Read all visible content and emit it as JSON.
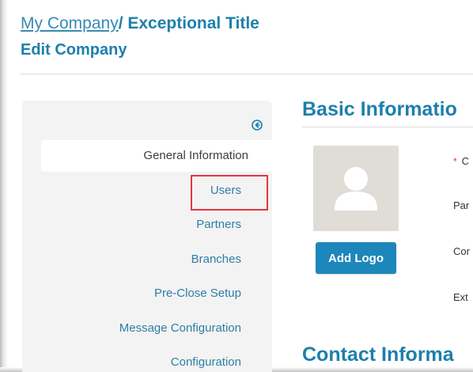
{
  "header": {
    "breadcrumb_root": "My Company",
    "breadcrumb_current": "/ Exceptional Title",
    "subtitle": "Edit Company"
  },
  "sidebar": {
    "collapse_icon": "collapse-left-circle-icon",
    "items": [
      {
        "label": "General Information",
        "active": true
      },
      {
        "label": "Users",
        "active": false,
        "highlighted": true
      },
      {
        "label": "Partners",
        "active": false
      },
      {
        "label": "Branches",
        "active": false
      },
      {
        "label": "Pre-Close Setup",
        "active": false
      },
      {
        "label": "Message Configuration",
        "active": false
      },
      {
        "label": "Configuration",
        "active": false
      }
    ]
  },
  "main": {
    "basic_info_title": "Basic Informatio",
    "contact_info_title": "Contact Informa",
    "logo_placeholder_icon": "user-avatar-icon",
    "add_logo_label": "Add Logo",
    "required_marker": "*",
    "field_labels": [
      "C",
      "Par",
      "Cor",
      "Ext"
    ]
  },
  "colors": {
    "accent": "#1e7fab",
    "button": "#1d86bb",
    "highlight": "#e2373d",
    "sidebar_bg": "#f3f3f3"
  }
}
